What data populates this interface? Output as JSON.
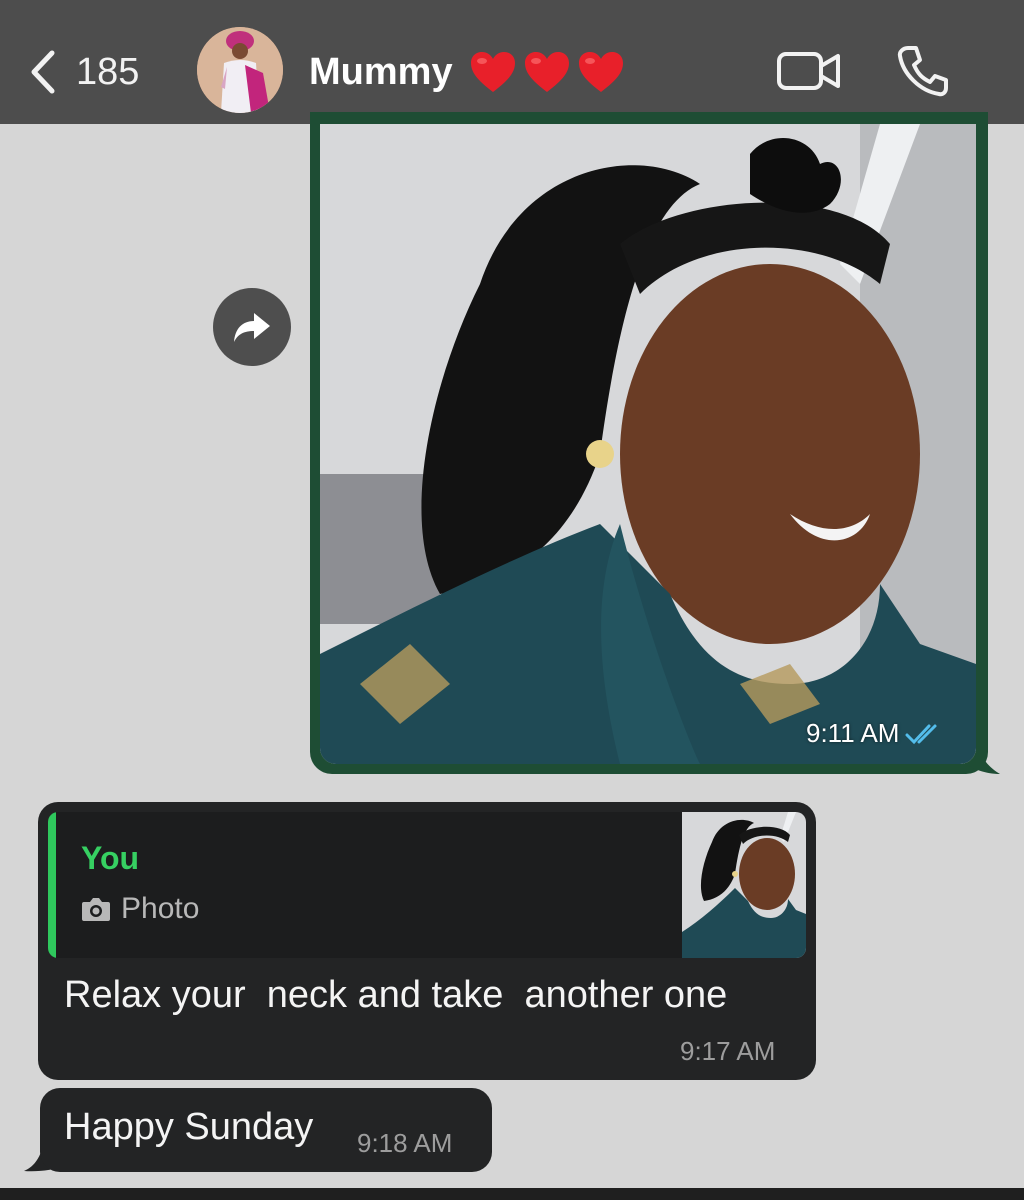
{
  "header": {
    "back_count": "185",
    "contact_name": "Mummy",
    "heart_count": 3,
    "icons": [
      "chevron-left-icon",
      "video-call-icon",
      "phone-call-icon"
    ]
  },
  "messages": {
    "photo": {
      "time": "9:11 AM",
      "status_icon": "double-check-icon",
      "status": "read"
    },
    "reply": {
      "quote_author": "You",
      "quote_type": "Photo",
      "text": "Relax your  neck and take  another one",
      "time": "9:17 AM"
    },
    "sunday": {
      "text": "Happy Sunday",
      "time": "9:18 AM"
    }
  },
  "colors": {
    "header_bg": "#4d4d4d",
    "chat_bg": "#d6d6d6",
    "outgoing_bubble": "#1e4d34",
    "incoming_bubble": "#232425",
    "quote_accent": "#2fc85d",
    "read_ticks": "#53bdeb",
    "heart": "#e8202a"
  }
}
